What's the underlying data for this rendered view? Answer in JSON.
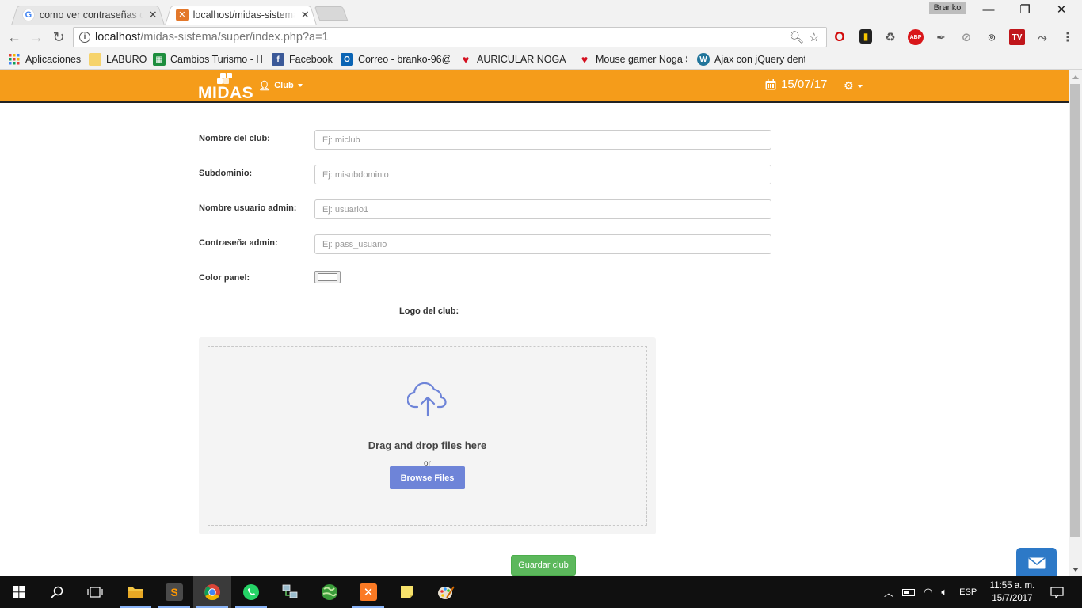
{
  "browser": {
    "tabs": [
      {
        "title": "como ver contraseñas de",
        "favicon": "google-icon",
        "active": false
      },
      {
        "title": "localhost/midas-sistema/",
        "favicon": "xampp-icon",
        "active": true
      }
    ],
    "profile_name": "Branko",
    "url_host": "localhost",
    "url_path": "/midas-sistema/super/index.php?a=1",
    "bookmarks": [
      {
        "label": "Aplicaciones",
        "icon": "apps-grid-icon"
      },
      {
        "label": "LABURO",
        "icon": "folder-icon"
      },
      {
        "label": "Cambios Turismo - H",
        "icon": "sheets-icon"
      },
      {
        "label": "Facebook",
        "icon": "facebook-icon"
      },
      {
        "label": "Correo - branko-96@",
        "icon": "outlook-icon"
      },
      {
        "label": "AURICULAR NOGA N",
        "icon": "heart-icon"
      },
      {
        "label": "Mouse gamer Noga S",
        "icon": "heart-icon"
      },
      {
        "label": "Ajax con jQuery dent",
        "icon": "wordpress-icon"
      }
    ]
  },
  "navbar": {
    "logo_text": "MIDAS",
    "club_menu": "Club",
    "date": "15/07/17"
  },
  "form": {
    "fields": [
      {
        "label": "Nombre del club:",
        "placeholder": "Ej: miclub"
      },
      {
        "label": "Subdominio:",
        "placeholder": "Ej: misubdominio"
      },
      {
        "label": "Nombre usuario admin:",
        "placeholder": "Ej: usuario1"
      },
      {
        "label": "Contraseña admin:",
        "placeholder": "Ej: pass_usuario"
      }
    ],
    "color_label": "Color panel:",
    "color_value": "#ffffff",
    "logo_label": "Logo del club:",
    "dropzone_title": "Drag and drop files here",
    "dropzone_or": "or",
    "browse_button": "Browse Files",
    "save_button": "Guardar club"
  },
  "taskbar": {
    "language": "ESP",
    "time": "11:55 a. m.",
    "date": "15/7/2017"
  },
  "colors": {
    "navbar": "#f59c1a",
    "browse_button": "#6e84d8",
    "save_button": "#5cb85c",
    "mail_button": "#2d79c7"
  }
}
